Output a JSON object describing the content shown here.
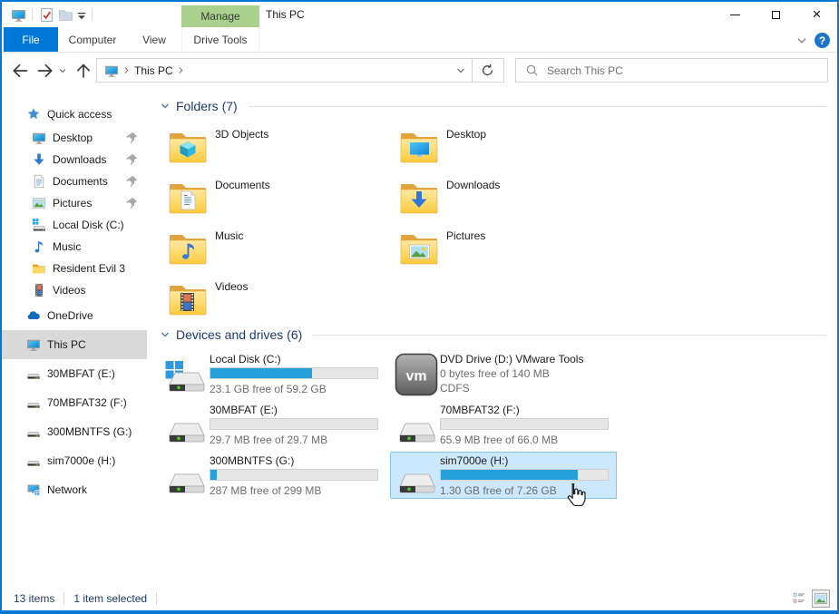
{
  "titlebar": {
    "title": "This PC",
    "contextual_header": "Manage",
    "qat_icons": [
      "computer",
      "properties-check",
      "new-folder",
      "qat-dropdown"
    ]
  },
  "ribbon": {
    "tabs": [
      {
        "label": "File",
        "active": true
      },
      {
        "label": "Computer",
        "active": false
      },
      {
        "label": "View",
        "active": false
      },
      {
        "label": "Drive Tools",
        "contextual": true
      }
    ]
  },
  "navbar": {
    "breadcrumb_root": "This PC",
    "search_placeholder": "Search This PC"
  },
  "sidebar": {
    "items": [
      {
        "label": "Quick access",
        "icon": "star",
        "level": 0,
        "pinned": false,
        "selected": false
      },
      {
        "label": "Desktop",
        "icon": "desktop",
        "level": 1,
        "pinned": true,
        "selected": false
      },
      {
        "label": "Downloads",
        "icon": "downloads",
        "level": 1,
        "pinned": true,
        "selected": false
      },
      {
        "label": "Documents",
        "icon": "document",
        "level": 1,
        "pinned": true,
        "selected": false
      },
      {
        "label": "Pictures",
        "icon": "pictures",
        "level": 1,
        "pinned": true,
        "selected": false
      },
      {
        "label": "Local Disk (C:)",
        "icon": "disk-c",
        "level": 1,
        "pinned": false,
        "selected": false
      },
      {
        "label": "Music",
        "icon": "music",
        "level": 1,
        "pinned": false,
        "selected": false
      },
      {
        "label": "Resident Evil 3",
        "icon": "folder",
        "level": 1,
        "pinned": false,
        "selected": false
      },
      {
        "label": "Videos",
        "icon": "videos",
        "level": 1,
        "pinned": false,
        "selected": false
      },
      {
        "label": "OneDrive",
        "icon": "onedrive",
        "level": 0,
        "pinned": false,
        "selected": false
      },
      {
        "label": "This PC",
        "icon": "thispc",
        "level": 0,
        "pinned": false,
        "selected": true
      },
      {
        "label": "30MBFAT (E:)",
        "icon": "drive16",
        "level": 0,
        "pinned": false,
        "selected": false
      },
      {
        "label": "70MBFAT32 (F:)",
        "icon": "drive16",
        "level": 0,
        "pinned": false,
        "selected": false
      },
      {
        "label": "300MBNTFS (G:)",
        "icon": "drive16",
        "level": 0,
        "pinned": false,
        "selected": false
      },
      {
        "label": "sim7000e (H:)",
        "icon": "drive16",
        "level": 0,
        "pinned": false,
        "selected": false
      },
      {
        "label": "Network",
        "icon": "network",
        "level": 0,
        "pinned": false,
        "selected": false
      }
    ]
  },
  "main": {
    "groups": [
      {
        "title": "Folders (7)",
        "items": [
          {
            "label": "3D Objects",
            "icon": "folder-3d-objects"
          },
          {
            "label": "Desktop",
            "icon": "folder-desktop"
          },
          {
            "label": "Documents",
            "icon": "folder-documents"
          },
          {
            "label": "Downloads",
            "icon": "folder-downloads"
          },
          {
            "label": "Music",
            "icon": "folder-music"
          },
          {
            "label": "Pictures",
            "icon": "folder-pictures"
          },
          {
            "label": "Videos",
            "icon": "folder-videos"
          }
        ]
      },
      {
        "title": "Devices and drives (6)",
        "items": [
          {
            "label": "Local Disk (C:)",
            "icon": "drive-windows",
            "lines": [
              "23.1 GB free of 59.2 GB"
            ],
            "bar_pct": 61,
            "selected": false
          },
          {
            "label": "DVD Drive (D:) VMware Tools",
            "icon": "vmware",
            "lines": [
              "0 bytes free of 140 MB",
              "CDFS"
            ],
            "bar_pct": null,
            "selected": false
          },
          {
            "label": "30MBFAT (E:)",
            "icon": "drive48",
            "lines": [
              "29.7 MB free of 29.7 MB"
            ],
            "bar_pct": 0,
            "selected": false
          },
          {
            "label": "70MBFAT32 (F:)",
            "icon": "drive48",
            "lines": [
              "65.9 MB free of 66.0 MB"
            ],
            "bar_pct": 0,
            "selected": false
          },
          {
            "label": "300MBNTFS (G:)",
            "icon": "drive48",
            "lines": [
              "287 MB free of 299 MB"
            ],
            "bar_pct": 4,
            "selected": false
          },
          {
            "label": "sim7000e (H:)",
            "icon": "drive48",
            "lines": [
              "1.30 GB free of 7.26 GB"
            ],
            "bar_pct": 82,
            "selected": true
          }
        ]
      }
    ]
  },
  "statusbar": {
    "items_count": "13 items",
    "selection": "1 item selected",
    "active_view": "thumbnail-view"
  },
  "colors": {
    "accent": "#0078d7",
    "contextual_tab": "#a9d18d",
    "selection_bg": "#cce8ff",
    "selection_border": "#84c3eb",
    "bar_fill": "#26a0da",
    "group_header_text": "#1d3a6d"
  }
}
